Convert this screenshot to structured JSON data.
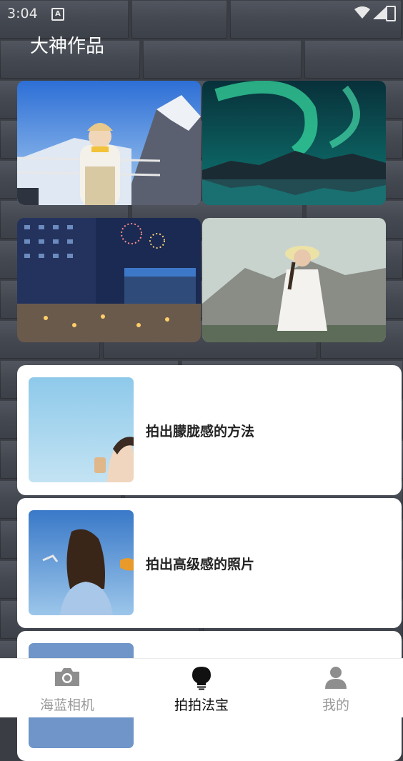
{
  "status_bar": {
    "time": "3:04"
  },
  "page": {
    "title": "大神作品"
  },
  "gallery": [
    {
      "name": "snow-mountain-girl"
    },
    {
      "name": "aurora-lake"
    },
    {
      "name": "night-city-fireworks"
    },
    {
      "name": "girl-hat-mountain"
    }
  ],
  "articles": [
    {
      "title": "拍出朦胧感的方法"
    },
    {
      "title": "拍出高级感的照片"
    },
    {
      "title": ""
    }
  ],
  "tabs": [
    {
      "label": "海蓝相机",
      "icon": "camera-icon",
      "active": false
    },
    {
      "label": "拍拍法宝",
      "icon": "lightbulb-icon",
      "active": true
    },
    {
      "label": "我的",
      "icon": "person-icon",
      "active": false
    }
  ],
  "colors": {
    "active_tab": "#111111",
    "inactive_tab": "#9a9a9a",
    "card_bg": "#ffffff"
  }
}
